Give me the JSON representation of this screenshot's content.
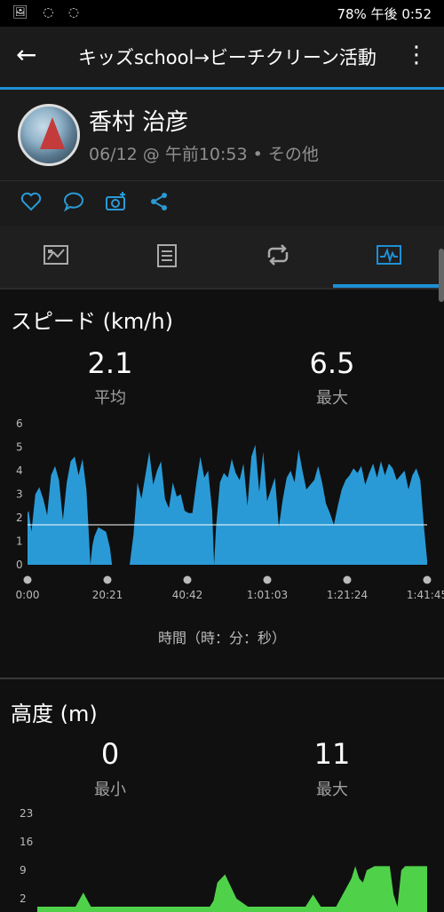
{
  "status": {
    "left_icons": "🖼 ◌ ◌",
    "right": "78% 午後 0:52"
  },
  "appbar": {
    "title": "キッズschool→ビーチクリーン活動"
  },
  "profile": {
    "name": "香村 治彦",
    "meta": "06/12 @ 午前10:53 • その他"
  },
  "tabs": [
    "summary-tab",
    "details-tab",
    "laps-tab",
    "charts-tab"
  ],
  "speed": {
    "title": "スピード (km/h)",
    "avg_value": "2.1",
    "avg_label": "平均",
    "max_value": "6.5",
    "max_label": "最大",
    "x_axis_title": "時間（時：分：秒）"
  },
  "elevation": {
    "title": "高度 (m)",
    "min_value": "0",
    "min_label": "最小",
    "max_value": "11",
    "max_label": "最大"
  },
  "colors": {
    "accent": "#1e90d6",
    "speed_fill": "#2a9ad6",
    "elevation_fill": "#4fd24a"
  },
  "chart_data": [
    {
      "type": "area",
      "title": "スピード (km/h)",
      "xlabel": "時間（時：分：秒）",
      "ylim": [
        0,
        6
      ],
      "y_ticks": [
        "0",
        "1",
        "2",
        "3",
        "4",
        "5",
        "6"
      ],
      "x_ticks": [
        "0:00",
        "20:21",
        "40:42",
        "1:01:03",
        "1:21:24",
        "1:41:45"
      ],
      "reference_line": 1.7,
      "x": [
        0,
        0.3,
        1,
        2,
        3,
        4,
        5,
        6,
        7,
        8,
        9,
        10,
        11,
        12,
        13,
        14,
        15,
        15.5,
        16,
        16.5,
        17,
        18,
        19,
        20,
        21,
        21.5,
        22,
        26,
        27,
        28,
        29,
        30,
        31,
        32,
        33,
        34,
        35,
        36,
        37,
        38,
        39,
        40,
        41,
        42,
        43,
        44,
        45,
        46,
        47,
        47.5,
        48,
        49,
        50,
        51,
        52,
        53,
        54,
        55,
        56,
        57,
        58,
        59,
        60,
        61,
        62,
        63,
        64,
        65,
        66,
        67,
        68,
        69,
        70,
        71,
        72,
        73,
        74,
        75,
        76,
        77,
        78,
        79,
        80,
        81,
        82,
        83,
        84,
        85,
        86,
        87,
        88,
        89,
        90,
        91,
        92,
        93,
        94,
        95,
        96,
        97,
        98,
        99,
        100,
        101,
        101.75
      ],
      "values": [
        2.2,
        2.3,
        1.4,
        3.0,
        3.3,
        2.8,
        2.1,
        3.8,
        4.2,
        3.6,
        1.9,
        3.5,
        4.4,
        4.6,
        3.8,
        4.5,
        3.2,
        1.6,
        0,
        0.8,
        1.2,
        1.6,
        1.5,
        1.4,
        0.7,
        0,
        0,
        0,
        1.3,
        3.5,
        2.8,
        3.8,
        4.8,
        3.4,
        4.0,
        4.4,
        2.8,
        2.4,
        3.5,
        2.9,
        3.0,
        2.3,
        2.2,
        2.2,
        3.5,
        4.6,
        3.7,
        4.0,
        2.3,
        0,
        1.6,
        3.5,
        3.9,
        3.7,
        4.5,
        3.9,
        3.6,
        4.3,
        2.5,
        4.6,
        5.1,
        3.1,
        4.8,
        2.7,
        3.2,
        3.7,
        1.6,
        2.8,
        3.7,
        4.0,
        3.5,
        4.9,
        4.0,
        3.2,
        3.4,
        3.6,
        4.2,
        3.5,
        2.6,
        2.2,
        1.7,
        2.5,
        3.2,
        3.6,
        3.8,
        4.1,
        3.9,
        4.2,
        3.4,
        3.9,
        4.3,
        3.7,
        4.4,
        3.8,
        4.3,
        4.1,
        3.6,
        3.8,
        4.0,
        3.2,
        3.8,
        4.1,
        3.6,
        1.5,
        0.2
      ]
    },
    {
      "type": "area",
      "title": "高度 (m)",
      "ylim": [
        0,
        23
      ],
      "y_ticks": [
        "2",
        "9",
        "16",
        "23"
      ],
      "x": [
        0,
        5,
        10,
        12,
        14,
        18,
        30,
        40,
        45,
        46,
        47,
        49,
        52,
        55,
        60,
        70,
        72,
        74,
        78,
        82,
        83,
        84,
        85,
        86,
        88,
        90,
        92,
        93,
        94,
        95,
        96,
        100,
        101.75
      ],
      "values": [
        0,
        0,
        0,
        3.5,
        0,
        0,
        0,
        0,
        0,
        1.5,
        6,
        8,
        2,
        0,
        0,
        0,
        3,
        0,
        0,
        7,
        10,
        7,
        6,
        9,
        10,
        10,
        10,
        3,
        0,
        9,
        10,
        10,
        10
      ]
    }
  ]
}
